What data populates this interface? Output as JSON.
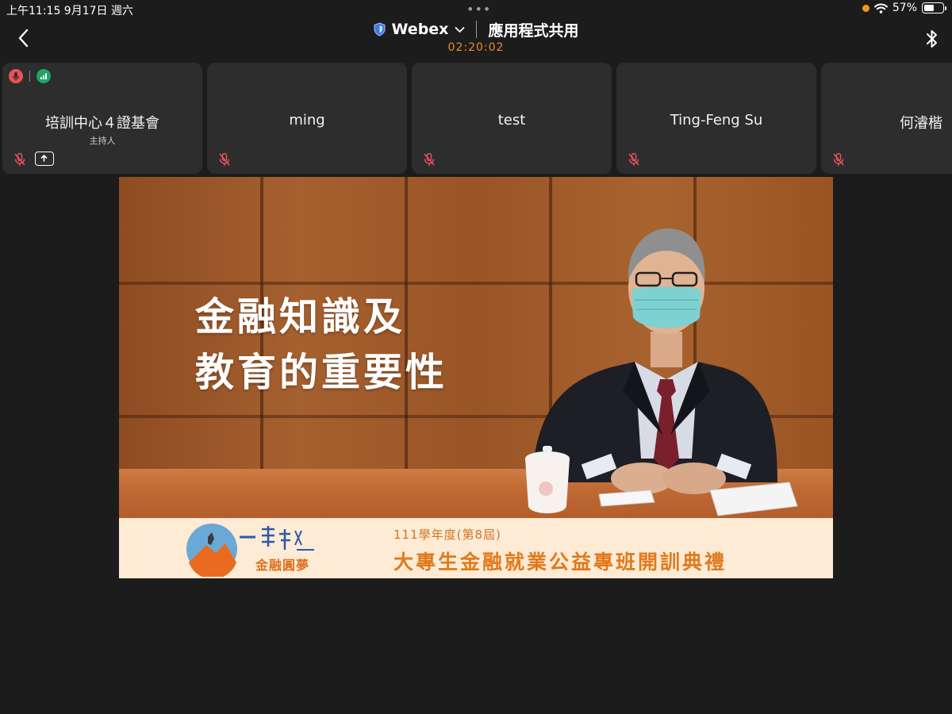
{
  "status_bar": {
    "time": "上午11:15   9月17日 週六",
    "dots": "•••",
    "battery_text": "57%",
    "battery_level": 0.57
  },
  "header": {
    "app_name": "Webex",
    "mode": "應用程式共用",
    "timer": "02:20:02"
  },
  "participants": [
    {
      "name": "培訓中心４證基會",
      "role": "主持人",
      "muted": true,
      "sharing": true
    },
    {
      "name": "ming",
      "muted": true
    },
    {
      "name": "test",
      "muted": true
    },
    {
      "name": "Ting-Feng Su",
      "muted": true
    },
    {
      "name": "何濬楷",
      "muted": true
    }
  ],
  "shared_content": {
    "headline_line1": "金融知識及",
    "headline_line2": "教育的重要性",
    "caption_small": "111學年度(第8屆)",
    "caption_big": "大專生金融就業公益專班開訓典禮",
    "logo_text": "金融圓夢"
  },
  "colors": {
    "accent_orange": "#f08a24",
    "muted_red": "#e8515a",
    "tile_bg": "#2d2d2d"
  }
}
